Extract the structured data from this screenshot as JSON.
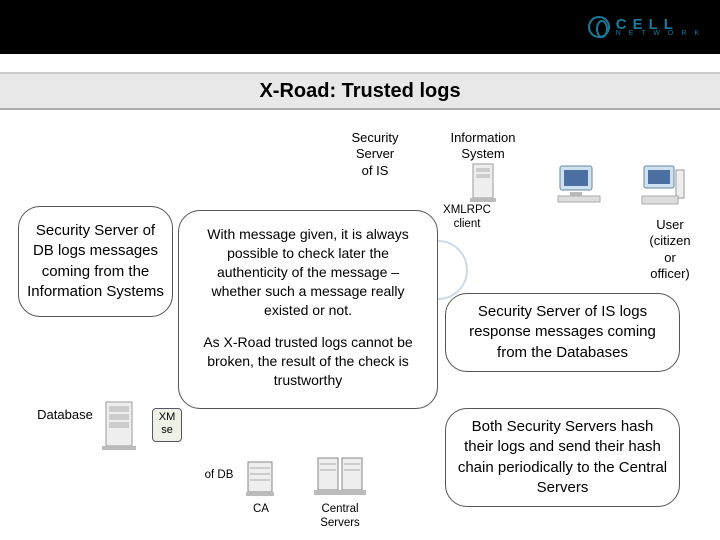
{
  "header": {
    "logo_text": "CELL",
    "logo_sub": "N E T W O R K"
  },
  "title": "X-Road: Trusted logs",
  "labels": {
    "security_server_is": "Security\nServer\nof IS",
    "information_system": "Information\nSystem",
    "xmlrpc_client": "XMLRPC\nclient",
    "user": "User\n(citizen\nor\nofficer)",
    "database": "Database",
    "xmlrpc_server_short": "XM\nse",
    "of_db": "of DB",
    "ca": "CA",
    "central_servers": "Central\nServers"
  },
  "bubbles": {
    "left": "Security Server of DB logs messages coming from the Information Systems",
    "center_p1": "With message given, it is always possible to check later the authenticity of the message – whether such a message really existed or not.",
    "center_p2": "As X-Road trusted logs cannot be broken, the result of the check is trustworthy",
    "right_top": "Security Server of IS logs response messages coming from the Databases",
    "right_bottom": "Both Security Servers hash their logs and send their hash chain periodically to the Central Servers"
  }
}
